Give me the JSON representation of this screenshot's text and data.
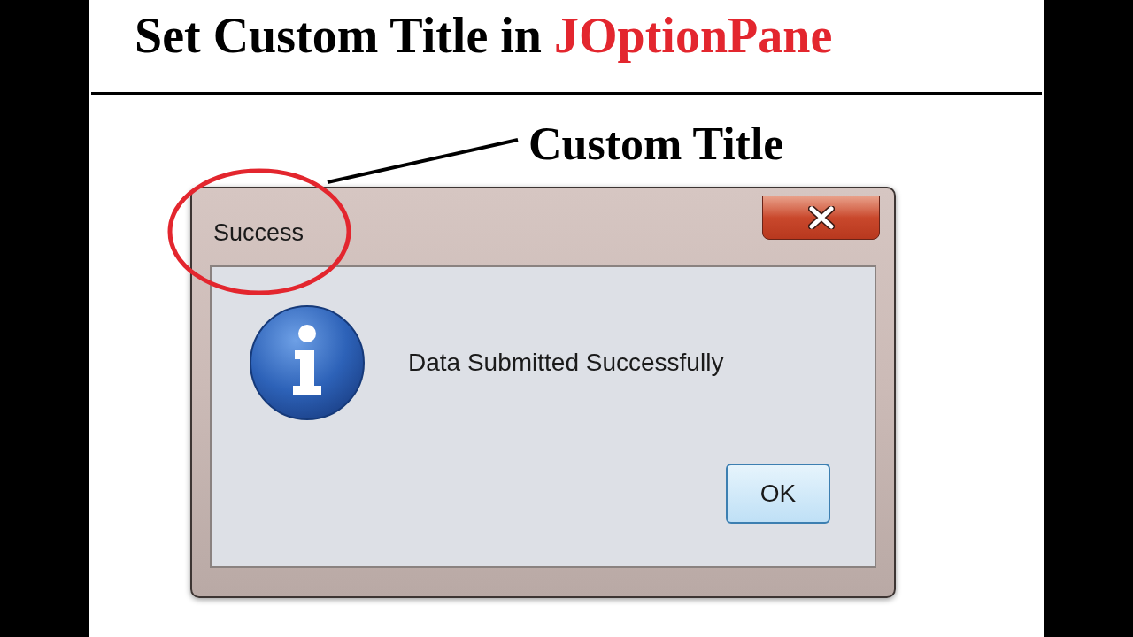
{
  "heading": {
    "text": "Set Custom Title in",
    "highlight": "JOptionPane"
  },
  "annotation": {
    "label": "Custom Title"
  },
  "dialog": {
    "title": "Success",
    "message": "Data Submitted Successfully",
    "buttons": [
      "OK"
    ]
  }
}
